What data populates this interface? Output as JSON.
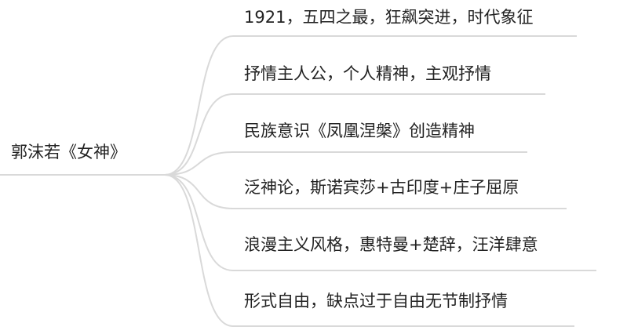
{
  "mindmap": {
    "root": "郭沫若《女神》",
    "branches": [
      "1921，五四之最，狂飙突进，时代象征",
      "抒情主人公，个人精神，主观抒情",
      "民族意识《凤凰涅槃》创造精神",
      "泛神论，斯诺宾莎+古印度+庄子屈原",
      "浪漫主义风格，惠特曼+楚辞，汪洋肆意",
      "形式自由，缺点过于自由无节制抒情"
    ],
    "line_color": "#d9d9d9"
  }
}
